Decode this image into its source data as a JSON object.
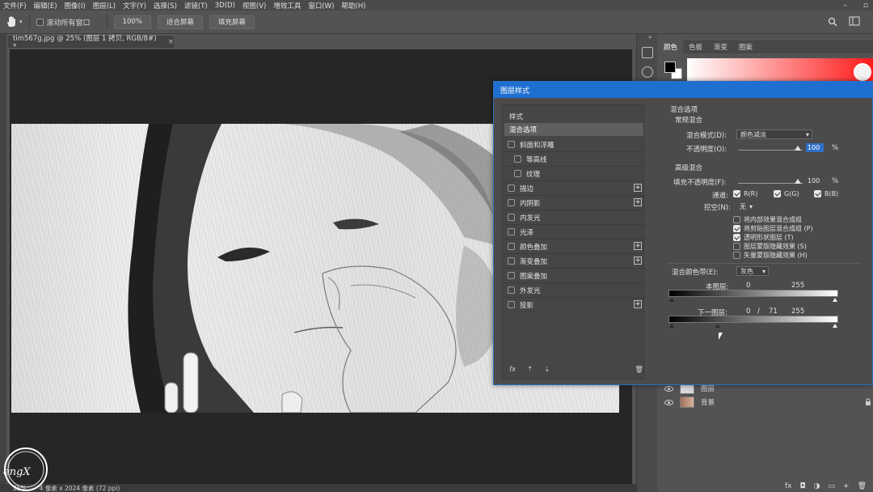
{
  "menu": [
    "文件(F)",
    "编辑(E)",
    "图像(I)",
    "图层(L)",
    "文字(Y)",
    "选择(S)",
    "滤镜(T)",
    "3D(D)",
    "视图(V)",
    "增效工具",
    "窗口(W)",
    "帮助(H)"
  ],
  "window_controls": [
    "–",
    "▫"
  ],
  "options": {
    "scroll_all": "滚动所有窗口",
    "zoom": "100%",
    "fit_screen": "适合屏幕",
    "fill_screen": "填充屏幕"
  },
  "document_tab": {
    "title": "tim567g.jpg @ 25% (图层 1 拷贝, RGB/8#) *",
    "close": "×"
  },
  "status": {
    "zoom": "25%",
    "dims": "4 像素 x 2024 像素 (72 ppi)"
  },
  "logo_text": "engX",
  "panel_tabs": [
    "颜色",
    "色板",
    "渐变",
    "图案"
  ],
  "layers": [
    {
      "name": "图层"
    },
    {
      "name": "背景"
    }
  ],
  "layer_footer": [
    "fx",
    "◘",
    "◑",
    "▭",
    "+",
    "🗑"
  ],
  "dialog": {
    "title": "图层样式",
    "styles_header": "样式",
    "selected": "混合选项",
    "items": [
      {
        "label": "斜面和浮雕",
        "checked": false,
        "plus": false,
        "sub": false
      },
      {
        "label": "等高线",
        "checked": false,
        "plus": false,
        "sub": true
      },
      {
        "label": "纹理",
        "checked": false,
        "plus": false,
        "sub": true
      },
      {
        "label": "描边",
        "checked": false,
        "plus": true,
        "sub": false
      },
      {
        "label": "内阴影",
        "checked": false,
        "plus": true,
        "sub": false
      },
      {
        "label": "内发光",
        "checked": false,
        "plus": false,
        "sub": false
      },
      {
        "label": "光泽",
        "checked": false,
        "plus": false,
        "sub": false
      },
      {
        "label": "颜色叠加",
        "checked": false,
        "plus": true,
        "sub": false
      },
      {
        "label": "渐变叠加",
        "checked": false,
        "plus": true,
        "sub": false
      },
      {
        "label": "图案叠加",
        "checked": false,
        "plus": false,
        "sub": false
      },
      {
        "label": "外发光",
        "checked": false,
        "plus": false,
        "sub": false
      },
      {
        "label": "投影",
        "checked": false,
        "plus": true,
        "sub": false
      }
    ],
    "list_footer": {
      "fx": "fx",
      "up": "⇡",
      "down": "⇣",
      "trash": "🗑"
    },
    "blend_options_title": "混合选项",
    "general_blend": "常规混合",
    "blend_mode_label": "混合模式(D):",
    "blend_mode_value": "颜色减淡",
    "opacity_label": "不透明度(O):",
    "opacity_value": "100",
    "percent": "%",
    "advanced_blend": "高级混合",
    "fill_opacity_label": "填充不透明度(F):",
    "fill_opacity_value": "100",
    "channels_label": "通道:",
    "channels": [
      {
        "label": "R(R)",
        "checked": true
      },
      {
        "label": "G(G)",
        "checked": true
      },
      {
        "label": "B(B)",
        "checked": true
      }
    ],
    "knockout_label": "挖空(N):",
    "knockout_value": "无",
    "advanced_checks": [
      {
        "label": "将内部效果混合成组",
        "checked": false
      },
      {
        "label": "将剪贴图层混合成组 (P)",
        "checked": true
      },
      {
        "label": "透明形状图层 (T)",
        "checked": true
      },
      {
        "label": "图层蒙版隐藏效果 (S)",
        "checked": false
      },
      {
        "label": "矢量蒙版隐藏效果 (H)",
        "checked": false
      }
    ],
    "blend_if_label": "混合颜色带(E):",
    "blend_if_value": "灰色",
    "this_layer_label": "本图层:",
    "this_layer_low": "0",
    "this_layer_high": "255",
    "underlying_label": "下一图层:",
    "underlying_low": "0",
    "underlying_split": "/",
    "underlying_split_value": "71",
    "underlying_high": "255"
  }
}
